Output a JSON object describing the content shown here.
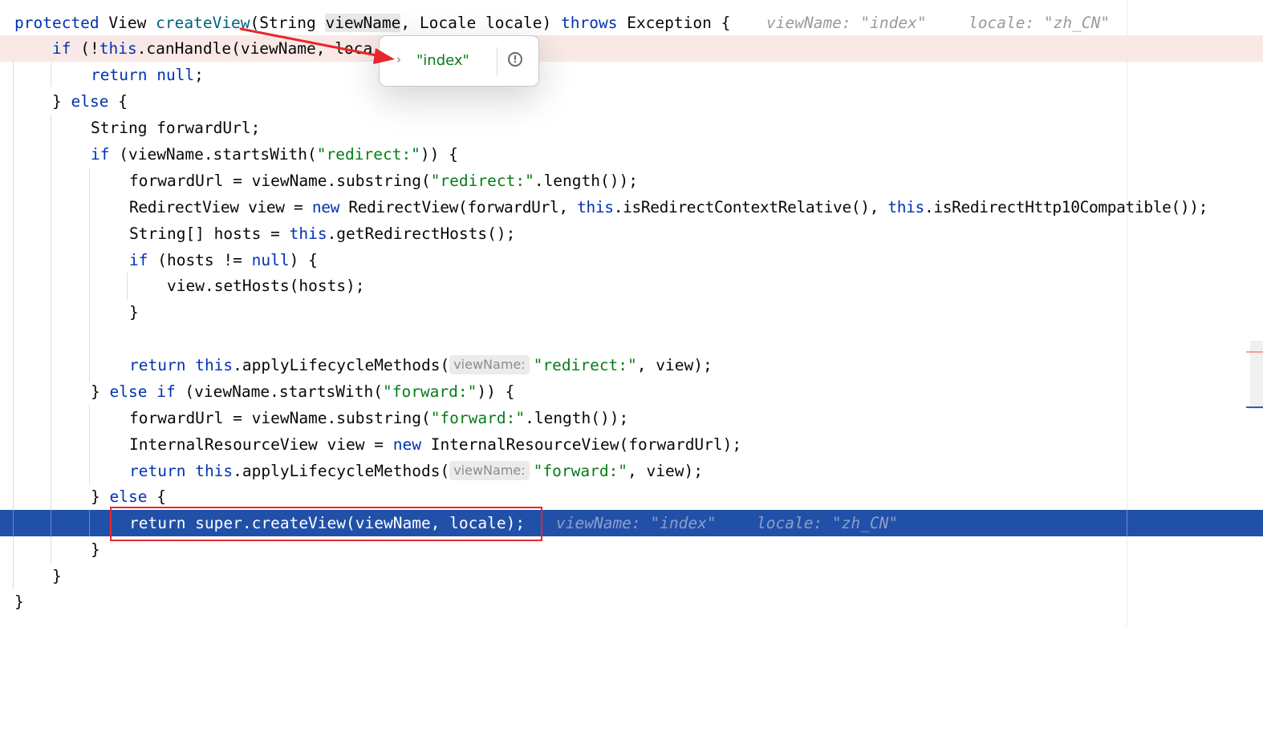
{
  "code": {
    "l1": {
      "protected": "protected",
      "view": "View",
      "createView": "createView",
      "paren_string": "(String",
      "viewName": "viewName",
      "locale_sig": ", Locale locale)",
      "throws": "throws",
      "exception": "Exception {",
      "hint_viewName": "viewName: \"index\"",
      "hint_locale": "locale: \"zh_CN\""
    },
    "l2": {
      "if": "if",
      "open": "(!",
      "this": "this",
      "rest": ".canHandle(viewName, loca"
    },
    "l3": {
      "return": "return",
      "null": "null",
      "semi": ";"
    },
    "l4": {
      "close": "}",
      "else": "else",
      "open": "{"
    },
    "l5": {
      "text": "String forwardUrl;"
    },
    "l6": {
      "if": "if",
      "a": "(viewName.startsWith(",
      "str": "\"redirect:\"",
      "b": ")) {"
    },
    "l7": {
      "a": "forwardUrl = viewName.substring(",
      "str": "\"redirect:\"",
      "b": ".length());"
    },
    "l8": {
      "a": "RedirectView view = ",
      "new": "new",
      "b": " RedirectView(forwardUrl, ",
      "this1": "this",
      "c": ".isRedirectContextRelative(), ",
      "this2": "this",
      "d": ".isRedirectHttp10Compatible());"
    },
    "l9": {
      "a": "String[] hosts = ",
      "this": "this",
      "b": ".getRedirectHosts();"
    },
    "l10": {
      "if": "if",
      "a": " (hosts != ",
      "null": "null",
      "b": ") {"
    },
    "l11": {
      "text": "view.setHosts(hosts);"
    },
    "l12": {
      "text": "}"
    },
    "l14": {
      "return": "return",
      "this": "this",
      "a": ".applyLifecycleMethods(",
      "hint": "viewName:",
      "str": "\"redirect:\"",
      "b": ", view);"
    },
    "l15": {
      "close": "}",
      "else_if": "else if",
      "a": " (viewName.startsWith(",
      "str": "\"forward:\"",
      "b": ")) {"
    },
    "l16": {
      "a": "forwardUrl = viewName.substring(",
      "str": "\"forward:\"",
      "b": ".length());"
    },
    "l17": {
      "a": "InternalResourceView view = ",
      "new": "new",
      "b": " InternalResourceView(forwardUrl);"
    },
    "l18": {
      "return": "return",
      "this": "this",
      "a": ".applyLifecycleMethods(",
      "hint": "viewName:",
      "str": "\"forward:\"",
      "b": ", view);"
    },
    "l19": {
      "close": "}",
      "else": "else",
      "open": "{"
    },
    "l20": {
      "text": "return super.createView(viewName, locale);",
      "hint_viewName": "viewName: \"index\"",
      "hint_locale": "locale: \"zh_CN\""
    },
    "l21": {
      "text": "}"
    },
    "l22": {
      "text": "}"
    },
    "l23": {
      "text": "}"
    }
  },
  "popup": {
    "value": "\"index\"",
    "chevron": "›",
    "warn": "!"
  },
  "colors": {
    "keyword": "#0033b3",
    "method": "#00627a",
    "string": "#067d17",
    "current_line": "#2150a8",
    "breakpoint_line": "#f9e9e6",
    "annotation_red": "#e8262b"
  },
  "icons": {
    "popup_expand": "chevron-right-icon",
    "popup_info": "exclamation-circle-icon"
  }
}
